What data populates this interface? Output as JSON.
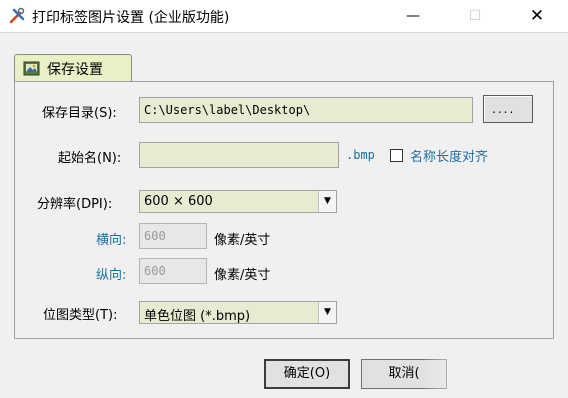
{
  "window": {
    "title": "打印标签图片设置 (企业版功能)",
    "minimize": "—",
    "maximize": "☐",
    "close": "✕"
  },
  "tab": {
    "label": "保存设置",
    "icon": "save-image-icon"
  },
  "form": {
    "save_dir": {
      "label": "保存目录(S):",
      "value": "C:\\Users\\label\\Desktop\\",
      "browse": "...."
    },
    "start_name": {
      "label": "起始名(N):",
      "value": "",
      "ext": ".bmp"
    },
    "name_align": {
      "label": "名称长度对齐",
      "checked": false
    },
    "dpi": {
      "label": "分辨率(DPI):",
      "value": "600 × 600"
    },
    "horizontal": {
      "label": "横向:",
      "value": "600",
      "unit": "像素/英寸"
    },
    "vertical": {
      "label": "纵向:",
      "value": "600",
      "unit": "像素/英寸"
    },
    "bitmap_type": {
      "label": "位图类型(T):",
      "value": "单色位图 (*.bmp)"
    }
  },
  "buttons": {
    "ok": "确定(O)",
    "cancel": "取消("
  },
  "colors": {
    "field_bg": "#e6ecd1",
    "tab_bg": "#e8f0c6",
    "accent_label": "#1d6fa5"
  }
}
